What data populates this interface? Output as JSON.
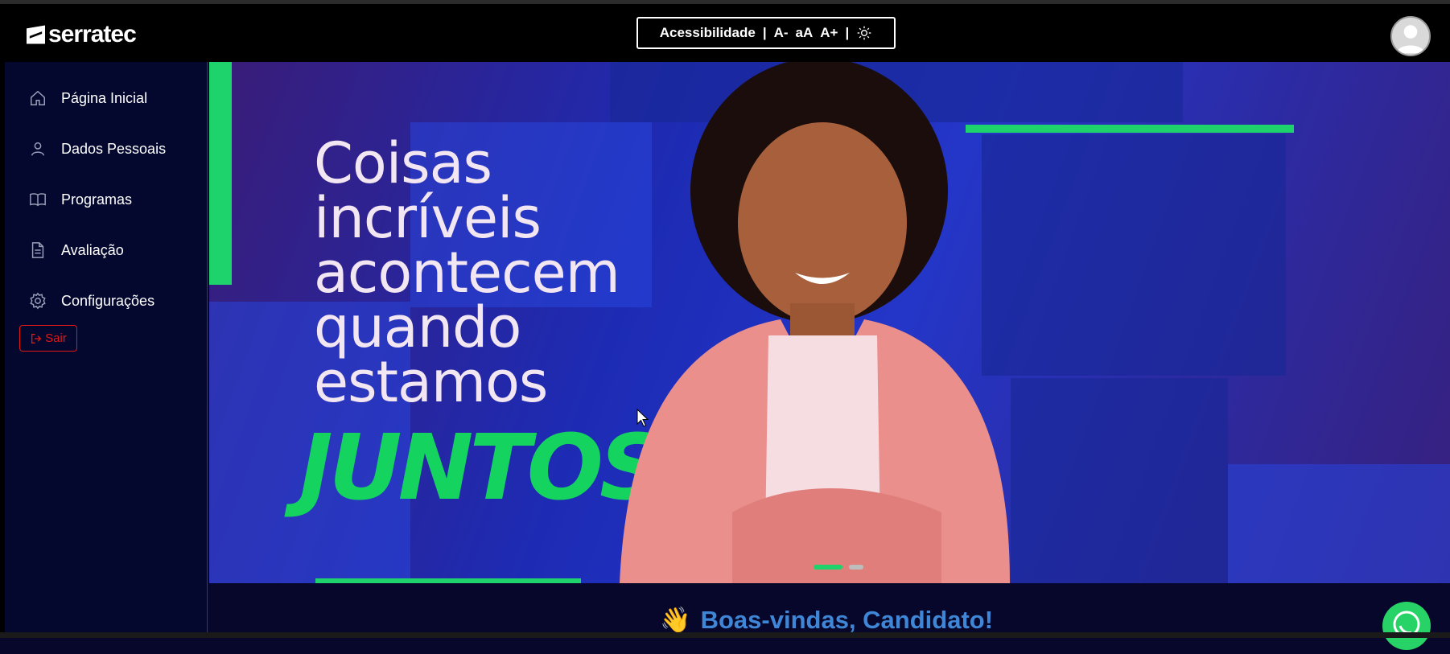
{
  "brand": {
    "logo_text": "serratec"
  },
  "accessibility": {
    "label": "Acessibilidade",
    "separator": "|",
    "decrease": "A-",
    "reset": "aA",
    "increase": "A+",
    "theme_icon": "sun-icon"
  },
  "sidebar": {
    "items": [
      {
        "label": "Página Inicial",
        "icon": "home-icon"
      },
      {
        "label": "Dados Pessoais",
        "icon": "user-icon"
      },
      {
        "label": "Programas",
        "icon": "book-icon"
      },
      {
        "label": "Avaliação",
        "icon": "document-icon"
      },
      {
        "label": "Configurações",
        "icon": "gear-icon"
      }
    ],
    "logout_label": "Sair"
  },
  "banner": {
    "lines": [
      "Coisas",
      "incríveis",
      "acontecem",
      "quando",
      "estamos"
    ],
    "highlight": "JUNTOS",
    "slides_total": 2,
    "active_slide": 1
  },
  "welcome": {
    "emoji": "👋",
    "text": "Boas-vindas, Candidato!"
  },
  "colors": {
    "accent_green": "#1ed36b",
    "sidebar_bg": "#04072e",
    "logout_red": "#e01818",
    "welcome_blue": "#3f87d6"
  }
}
